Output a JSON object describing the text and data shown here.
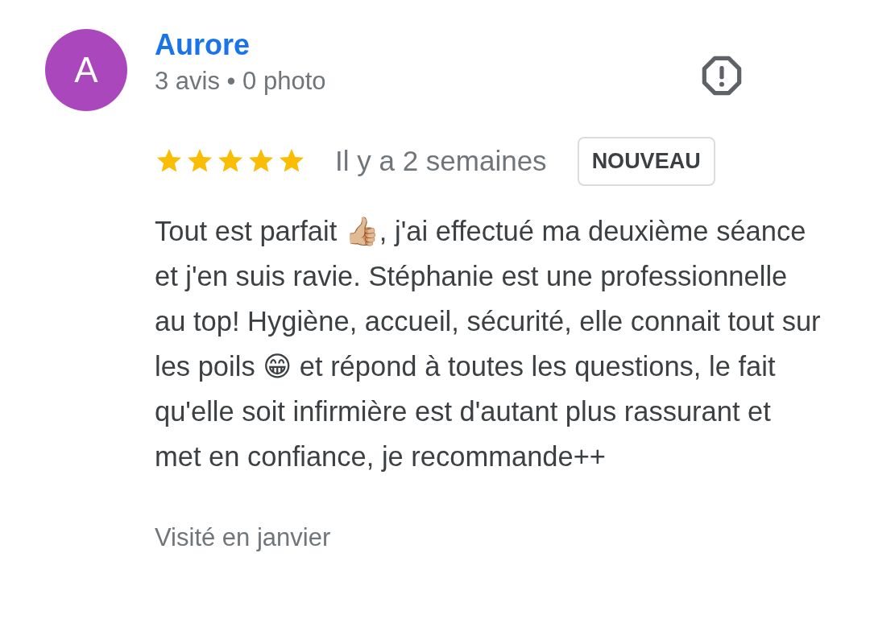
{
  "reviewer": {
    "initial": "A",
    "name": "Aurore",
    "meta": "3 avis • 0 photo"
  },
  "review": {
    "stars": 5,
    "time": "Il y a 2 semaines",
    "badge": "NOUVEAU",
    "text": "Tout est parfait 👍🏼, j'ai effectué ma deuxième séance et j'en suis ravie. Stéphanie est une professionnelle au top! Hygiène, accueil, sécurité, elle connait tout sur les poils 😁 et répond à toutes les questions, le fait qu'elle soit infirmière est d'autant plus rassurant et met en confiance, je recommande++",
    "visited": "Visité en janvier"
  }
}
